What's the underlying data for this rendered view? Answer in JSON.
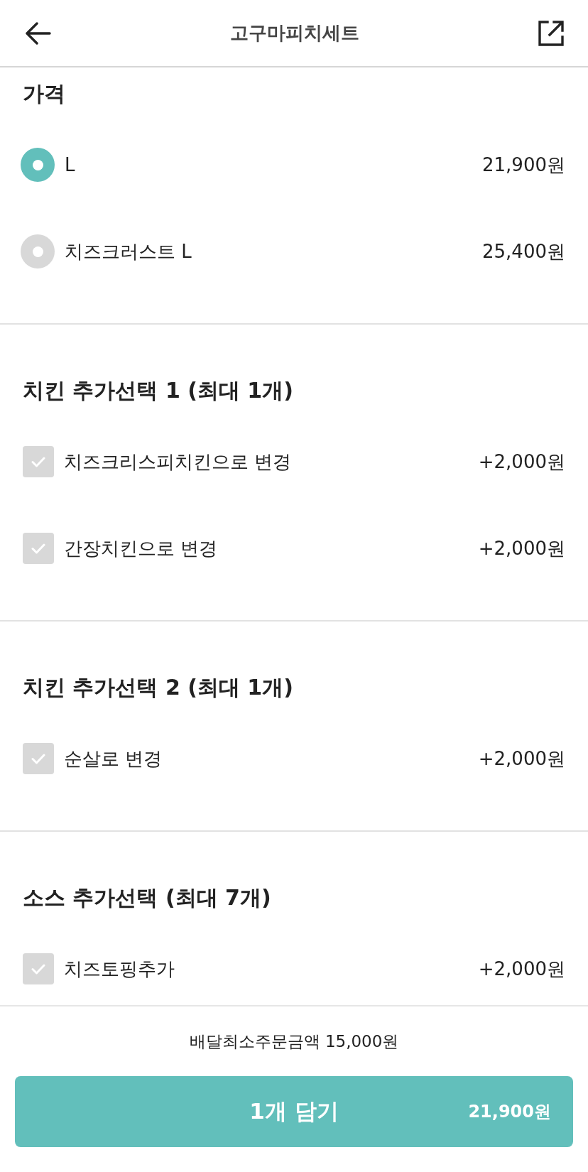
{
  "header": {
    "title": "고구마피치세트"
  },
  "sections": [
    {
      "title": "가격",
      "kind": "radio",
      "options": [
        {
          "label": "L",
          "price": "21,900원",
          "selected": true
        },
        {
          "label": "치즈크러스트 L",
          "price": "25,400원",
          "selected": false
        }
      ]
    },
    {
      "title": "치킨 추가선택 1 (최대 1개)",
      "kind": "checkbox",
      "options": [
        {
          "label": "치즈크리스피치킨으로 변경",
          "price": "+2,000원",
          "checked": false
        },
        {
          "label": "간장치킨으로 변경",
          "price": "+2,000원",
          "checked": false
        }
      ]
    },
    {
      "title": "치킨 추가선택 2 (최대 1개)",
      "kind": "checkbox",
      "options": [
        {
          "label": "순살로 변경",
          "price": "+2,000원",
          "checked": false
        }
      ]
    },
    {
      "title": "소스 추가선택 (최대 7개)",
      "kind": "checkbox",
      "options": [
        {
          "label": "치즈토핑추가",
          "price": "+2,000원",
          "checked": false
        }
      ]
    }
  ],
  "footer": {
    "minimum_order": "배달최소주문금액 15,000원",
    "cart_button": {
      "label": "1개 담기",
      "price": "21,900원"
    }
  }
}
